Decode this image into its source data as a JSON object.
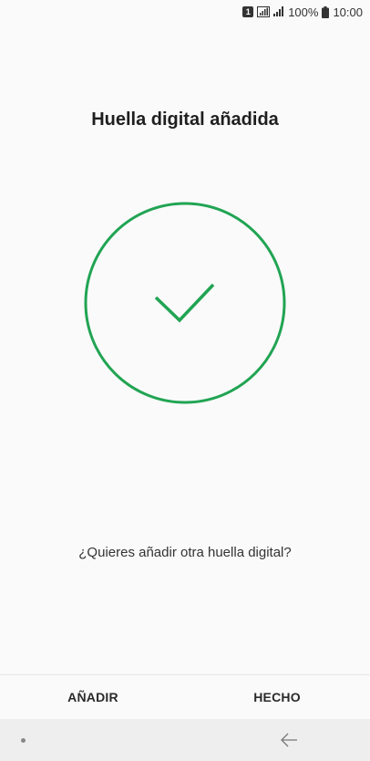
{
  "status_bar": {
    "sim_label": "1",
    "battery_text": "100%",
    "time": "10:00"
  },
  "screen": {
    "title": "Huella digital añadida",
    "question": "¿Quieres añadir otra huella digital?",
    "accent_color": "#21a453"
  },
  "actions": {
    "add_label": "AÑADIR",
    "done_label": "HECHO"
  },
  "navigation": {
    "home_icon": "dot-icon",
    "back_icon": "back-arrow-icon"
  }
}
